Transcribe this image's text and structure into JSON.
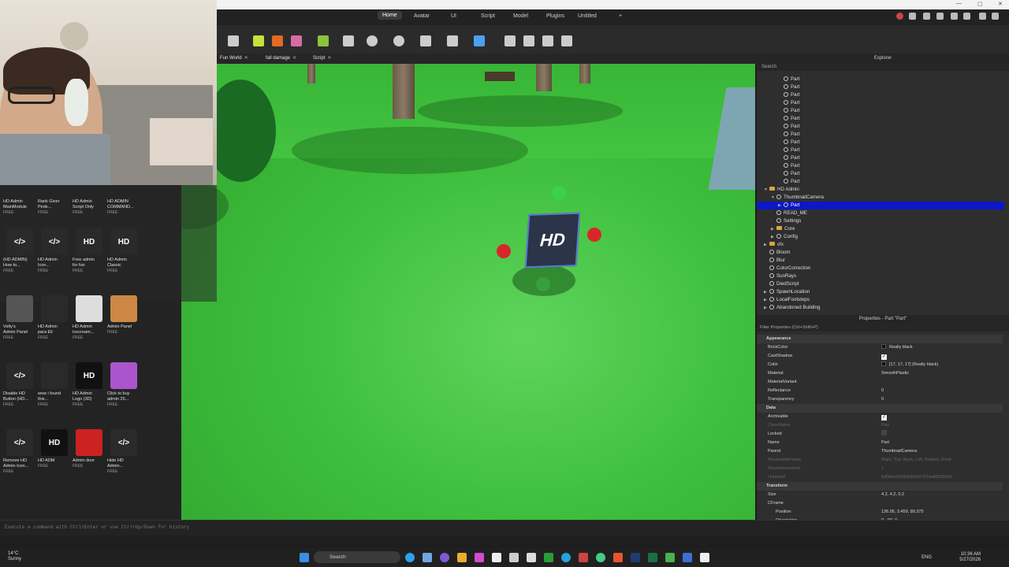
{
  "ribbon": {
    "tabs": [
      "Home",
      "Avatar",
      "UI",
      "Script",
      "Model",
      "Plugins",
      "Untitled",
      "+"
    ],
    "active_tab": "Home"
  },
  "doc_tabs": [
    {
      "label": "Fun World"
    },
    {
      "label": "fall damage"
    },
    {
      "label": "Script"
    }
  ],
  "toolbox": {
    "items": [
      {
        "name": "HD Admin\nMainModule",
        "price": "FREE",
        "thumb": ""
      },
      {
        "name": "Rank Giver\nPeds...",
        "price": "FREE",
        "thumb": ""
      },
      {
        "name": "HD Admin\nScript Only",
        "price": "FREE",
        "thumb": ""
      },
      {
        "name": "HD ADMIN\nCOMMAND...",
        "price": "FREE",
        "thumb": ""
      },
      {
        "name": "(HD ADMIN)\nHow to...",
        "price": "FREE",
        "thumb": "</>"
      },
      {
        "name": "HD Admin\nIcon...",
        "price": "FREE",
        "thumb": "</>"
      },
      {
        "name": "Free admin\nfor fun",
        "price": "FREE",
        "thumb": "HD"
      },
      {
        "name": "HD Admin\nClassic",
        "price": "FREE",
        "thumb": "HD"
      },
      {
        "name": "Volty's\nAdmin Panel",
        "price": "FREE",
        "thumb": ""
      },
      {
        "name": "HD Admin\npara Eli",
        "price": "FREE",
        "thumb": ""
      },
      {
        "name": "HD Admin\nIcecream...",
        "price": "FREE",
        "thumb": ""
      },
      {
        "name": "Admin Panel",
        "price": "FREE",
        "thumb": ""
      },
      {
        "name": "Disable HD\nButton (HD...",
        "price": "FREE",
        "thumb": "</>"
      },
      {
        "name": "wow i found\nthis...",
        "price": "FREE",
        "thumb": ""
      },
      {
        "name": "HD Admin\nLogo (3D)",
        "price": "FREE",
        "thumb": "HD"
      },
      {
        "name": "Click to buy\nadmin 25...",
        "price": "FREE",
        "thumb": ""
      },
      {
        "name": "Remove HD\nAdmin Icon...",
        "price": "FREE",
        "thumb": "</>"
      },
      {
        "name": "HD ADM",
        "price": "FREE",
        "thumb": "HD"
      },
      {
        "name": "Admin door",
        "price": "FREE",
        "thumb": ""
      },
      {
        "name": "Hide HD\nAdmin...",
        "price": "FREE",
        "thumb": "</>"
      }
    ]
  },
  "viewport": {
    "part_label": "HD"
  },
  "explorer": {
    "title": "Explorer",
    "search_placeholder": "Search",
    "rows": [
      {
        "label": "Part",
        "indent": 3,
        "icon": "part"
      },
      {
        "label": "Part",
        "indent": 3,
        "icon": "part"
      },
      {
        "label": "Part",
        "indent": 3,
        "icon": "part"
      },
      {
        "label": "Part",
        "indent": 3,
        "icon": "part"
      },
      {
        "label": "Part",
        "indent": 3,
        "icon": "part"
      },
      {
        "label": "Part",
        "indent": 3,
        "icon": "part"
      },
      {
        "label": "Part",
        "indent": 3,
        "icon": "part"
      },
      {
        "label": "Part",
        "indent": 3,
        "icon": "part"
      },
      {
        "label": "Part",
        "indent": 3,
        "icon": "part"
      },
      {
        "label": "Part",
        "indent": 3,
        "icon": "part"
      },
      {
        "label": "Part",
        "indent": 3,
        "icon": "part"
      },
      {
        "label": "Part",
        "indent": 3,
        "icon": "part"
      },
      {
        "label": "Part",
        "indent": 3,
        "icon": "part"
      },
      {
        "label": "Part",
        "indent": 3,
        "icon": "part"
      },
      {
        "label": "HD Admin",
        "indent": 1,
        "icon": "folder",
        "arrow": "▼"
      },
      {
        "label": "ThumbnailCamera",
        "indent": 2,
        "icon": "model",
        "arrow": "▼"
      },
      {
        "label": "Part",
        "indent": 3,
        "icon": "part",
        "arrow": "▶",
        "selected": true
      },
      {
        "label": "READ_ME",
        "indent": 2,
        "icon": "script"
      },
      {
        "label": "Settings",
        "indent": 2,
        "icon": "script"
      },
      {
        "label": "Core",
        "indent": 2,
        "icon": "folder",
        "arrow": "▶"
      },
      {
        "label": "Config",
        "indent": 2,
        "icon": "gear",
        "arrow": "▶"
      },
      {
        "label": "vfx",
        "indent": 1,
        "icon": "folder",
        "arrow": "▶"
      },
      {
        "label": "Bloom",
        "indent": 1,
        "icon": "fx"
      },
      {
        "label": "Blur",
        "indent": 1,
        "icon": "fx"
      },
      {
        "label": "ColorCorrection",
        "indent": 1,
        "icon": "fx"
      },
      {
        "label": "SunRays",
        "indent": 1,
        "icon": "fx"
      },
      {
        "label": "DiedScript",
        "indent": 1,
        "icon": "script"
      },
      {
        "label": "SpawnLocation",
        "indent": 1,
        "icon": "spawn",
        "arrow": "▶"
      },
      {
        "label": "LocalFootsteps",
        "indent": 1,
        "icon": "script",
        "arrow": "▶"
      },
      {
        "label": "Abandoned Building",
        "indent": 1,
        "icon": "model",
        "arrow": "▶"
      }
    ]
  },
  "properties": {
    "title": "Properties - Part \"Part\"",
    "filter_placeholder": "Filter Properties (Ctrl+Shift+P)",
    "rows": [
      {
        "type": "section",
        "name": "Appearance"
      },
      {
        "name": "BrickColor",
        "value": "Really black",
        "swatch": true
      },
      {
        "name": "CastShadow",
        "check": true
      },
      {
        "name": "Color",
        "value": "[17, 17, 17] (Really black)",
        "swatch": true
      },
      {
        "name": "Material",
        "value": "SmoothPlastic"
      },
      {
        "name": "MaterialVariant",
        "value": ""
      },
      {
        "name": "Reflectance",
        "value": "0"
      },
      {
        "name": "Transparency",
        "value": "0"
      },
      {
        "type": "section",
        "name": "Data"
      },
      {
        "name": "Archivable",
        "check": true
      },
      {
        "name": "ClassName",
        "value": "Part",
        "dim": true
      },
      {
        "name": "Locked",
        "check": false
      },
      {
        "name": "Name",
        "value": "Part"
      },
      {
        "name": "Parent",
        "value": "ThumbnailCamera"
      },
      {
        "name": "ResizeableFaces",
        "value": "Right, Top, Back, Left, Bottom, Front",
        "dim": true
      },
      {
        "name": "ResizeIncrement",
        "value": "1",
        "dim": true
      },
      {
        "name": "UniqueId",
        "value": "5d5b6a9f2bb90b0b0791da8992b0b0",
        "dim": true
      },
      {
        "type": "section",
        "name": "Transform"
      },
      {
        "name": "Size",
        "value": "4.2, 4.2, 0.2"
      },
      {
        "name": "CFrame",
        "value": ""
      },
      {
        "name": "Position",
        "value": "136.95, 3.459, 89.375",
        "sub": true
      },
      {
        "name": "Orientation",
        "value": "0, -90, 0",
        "sub": true
      }
    ]
  },
  "command_bar": {
    "placeholder": "Execute a command with Ctrl+Enter or use Ctrl+Up/Down for history"
  },
  "taskbar": {
    "weather_temp": "14°C",
    "weather_desc": "Sunny",
    "search_label": "Search",
    "lang": "ENG",
    "time": "10:36 AM",
    "date": "5/27/2026"
  }
}
